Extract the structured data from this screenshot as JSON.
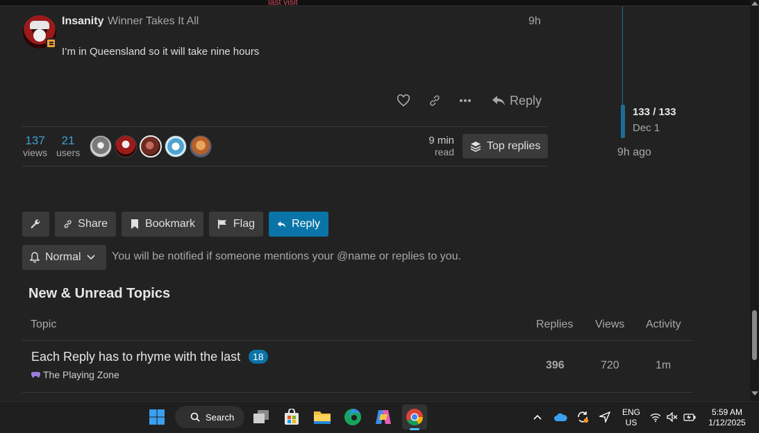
{
  "header": {
    "last_visit": "last visit"
  },
  "post": {
    "username": "Insanity",
    "user_title": "Winner Takes It All",
    "time": "9h",
    "body": "I’m in Queensland so it will take nine hours",
    "reply_label": "Reply"
  },
  "topic_map": {
    "views": {
      "value": "137",
      "label": "views"
    },
    "users": {
      "value": "21",
      "label": "users"
    },
    "read_time": {
      "value": "9 min",
      "label": "read"
    },
    "top_replies_label": "Top replies"
  },
  "timeline": {
    "count": "133 / 133",
    "date": "Dec 1",
    "ago": "9h ago"
  },
  "footer_buttons": {
    "share": "Share",
    "bookmark": "Bookmark",
    "flag": "Flag",
    "reply": "Reply"
  },
  "notifications": {
    "level": "Normal",
    "description": "You will be notified if someone mentions your @name or replies to you."
  },
  "suggested": {
    "title": "New & Unread Topics",
    "columns": {
      "topic": "Topic",
      "replies": "Replies",
      "views": "Views",
      "activity": "Activity"
    },
    "rows": [
      {
        "title": "Each Reply has to rhyme with the last",
        "unread": "18",
        "category": "The Playing Zone",
        "replies": "396",
        "views": "720",
        "activity": "1m"
      }
    ]
  },
  "taskbar": {
    "search_label": "Search",
    "language_1": "ENG",
    "language_2": "US",
    "time": "5:59 AM",
    "date": "1/12/2025"
  },
  "colors": {
    "accent": "#0a74a8",
    "link": "#3fa0d6",
    "background": "#222222"
  }
}
